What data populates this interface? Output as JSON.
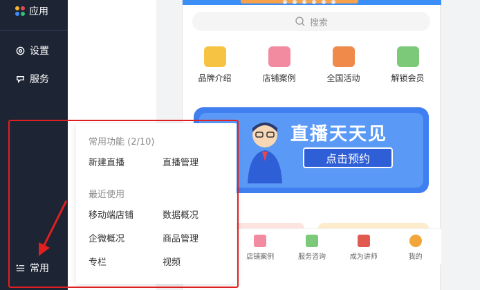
{
  "sidebar": {
    "items": [
      {
        "label": "应用",
        "icon": "apps-icon"
      },
      {
        "label": "设置",
        "icon": "gear-icon"
      },
      {
        "label": "服务",
        "icon": "service-icon"
      },
      {
        "label": "常用",
        "icon": "list-icon"
      }
    ]
  },
  "phone": {
    "search_placeholder": "搜索",
    "categories": [
      {
        "label": "品牌介绍",
        "color": "#f6c343"
      },
      {
        "label": "店铺案例",
        "color": "#f28aa0"
      },
      {
        "label": "全国活动",
        "color": "#f08a4b"
      },
      {
        "label": "解锁会员",
        "color": "#7cc97a"
      }
    ],
    "banner": {
      "title": "直播天天见",
      "button": "点击预约"
    },
    "bottom_nav": [
      {
        "label": "",
        "color": "#ffffff"
      },
      {
        "label": "店铺案例",
        "color": "#f28aa0"
      },
      {
        "label": "服务咨询",
        "color": "#7cc97a"
      },
      {
        "label": "成为讲师",
        "color": "#e05a4f"
      },
      {
        "label": "我的",
        "color": "#f0a63a"
      }
    ]
  },
  "popover": {
    "common_title": "常用功能 (2/10)",
    "common_items": [
      "新建直播",
      "直播管理"
    ],
    "recent_title": "最近使用",
    "recent_items": [
      "移动端店铺",
      "数据概况",
      "企微概况",
      "商品管理",
      "专栏",
      "视频"
    ]
  },
  "colors": {
    "sidebar_bg": "#1d2433",
    "annotation": "#e02020",
    "accent": "#3a8ef6"
  }
}
